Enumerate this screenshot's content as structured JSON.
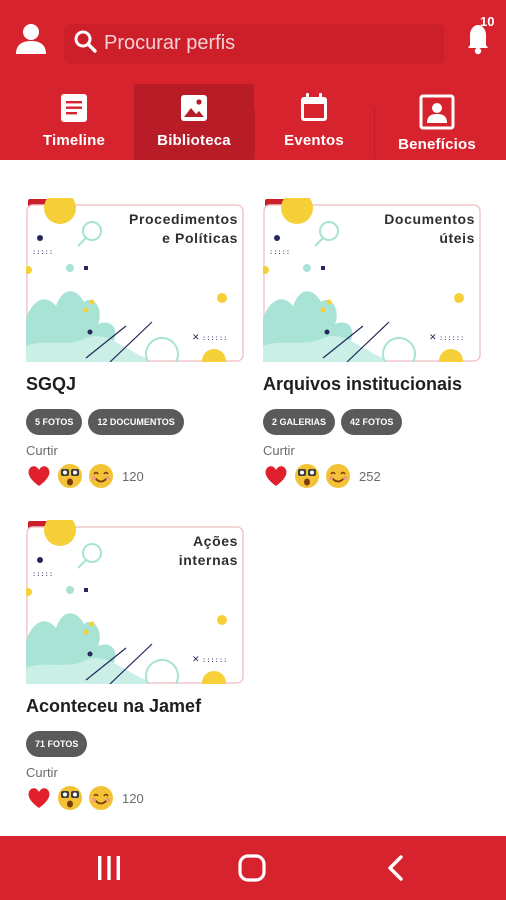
{
  "search": {
    "placeholder": "Procurar perfis"
  },
  "notifications": {
    "count": "10"
  },
  "tabs": [
    {
      "label": "Timeline",
      "icon": "document-icon"
    },
    {
      "label": "Biblioteca",
      "icon": "image-icon"
    },
    {
      "label": "Eventos",
      "icon": "calendar-icon"
    },
    {
      "label": "Benefícios",
      "icon": "portrait-icon"
    }
  ],
  "active_tab": "Biblioteca",
  "colors": {
    "brand": "#d7232e",
    "active_tab": "#b81d27",
    "badge": "#5a5a5a",
    "teal": "#a8e3d6",
    "yellow": "#f6d038",
    "navy": "#24285c"
  },
  "library": [
    {
      "thumb_title": "Procedimentos\ne Políticas",
      "title": "SGQJ",
      "badges": [
        "5 FOTOS",
        "12 DOCUMENTOS"
      ],
      "like_label": "Curtir",
      "reactions": [
        "heart-icon",
        "shocked-emoji-icon",
        "smile-emoji-icon"
      ],
      "count": "120"
    },
    {
      "thumb_title": "Documentos\núteis",
      "title": "Arquivos institucionais",
      "badges": [
        "2 GALERIAS",
        "42 FOTOS"
      ],
      "like_label": "Curtir",
      "reactions": [
        "heart-icon",
        "shocked-emoji-icon",
        "smile-emoji-icon"
      ],
      "count": "252"
    },
    {
      "thumb_title": "Ações\ninternas",
      "title": "Aconteceu na Jamef",
      "badges": [
        "71 FOTOS"
      ],
      "like_label": "Curtir",
      "reactions": [
        "heart-icon",
        "shocked-emoji-icon",
        "smile-emoji-icon"
      ],
      "count": "120"
    }
  ]
}
